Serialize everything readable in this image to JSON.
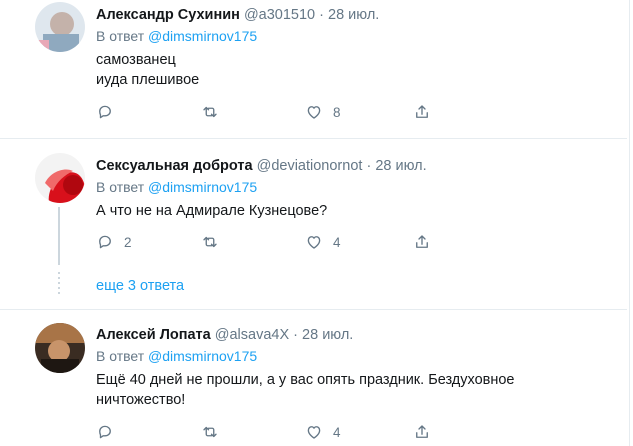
{
  "tweets": [
    {
      "name": "Александр Сухинин",
      "handle": "@a301510",
      "sep": "·",
      "date": "28 июл.",
      "reply_prefix": "В ответ",
      "reply_to": "@dimsmirnov175",
      "text_lines": [
        "самозванец",
        "иуда плешивое"
      ],
      "actions": {
        "reply_count": "",
        "retweet_count": "",
        "like_count": "8"
      },
      "avatar_colors": [
        "#d7e2ea",
        "#b9a9a3"
      ]
    },
    {
      "name": "Сексуальная доброта",
      "handle": "@deviationornot",
      "sep": "·",
      "date": "28 июл.",
      "reply_prefix": "В ответ",
      "reply_to": "@dimsmirnov175",
      "text_lines": [
        "А что не на Адмирале Кузнецове?"
      ],
      "actions": {
        "reply_count": "2",
        "retweet_count": "",
        "like_count": "4"
      },
      "avatar_colors": [
        "#ffffff",
        "#e0101a"
      ]
    },
    {
      "name": "Алексей Лопата",
      "handle": "@alsava4X",
      "sep": "·",
      "date": "28 июл.",
      "reply_prefix": "В ответ",
      "reply_to": "@dimsmirnov175",
      "text_lines": [
        "Ещё 40 дней не прошли, а у вас опять праздник. Бездуховное",
        "ничтожество!"
      ],
      "actions": {
        "reply_count": "",
        "retweet_count": "",
        "like_count": "4"
      },
      "avatar_colors": [
        "#9b6a3d",
        "#2b211a"
      ]
    }
  ],
  "more_replies": "еще 3 ответа",
  "icons": {
    "reply": "reply-icon",
    "retweet": "retweet-icon",
    "like": "heart-icon",
    "share": "share-icon"
  },
  "colors": {
    "link": "#1da1f2",
    "muted": "#657786",
    "text": "#14171a",
    "divider": "#e6ecf0"
  }
}
